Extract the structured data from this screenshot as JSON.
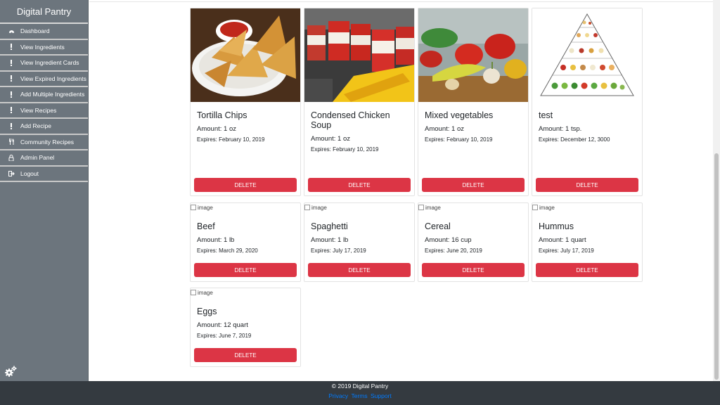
{
  "sidebar": {
    "brand": "Digital Pantry",
    "items": [
      {
        "label": "Dashboard",
        "icon": "dashboard-icon"
      },
      {
        "label": "View Ingredients",
        "icon": "exclamation-icon"
      },
      {
        "label": "View Ingredient Cards",
        "icon": "exclamation-icon"
      },
      {
        "label": "View Expired Ingredients",
        "icon": "exclamation-icon"
      },
      {
        "label": "Add Multiple Ingredients",
        "icon": "exclamation-icon"
      },
      {
        "label": "View Recipes",
        "icon": "exclamation-icon"
      },
      {
        "label": "Add Recipe",
        "icon": "exclamation-icon"
      },
      {
        "label": "Community Recipes",
        "icon": "utensils-icon"
      },
      {
        "label": "Admin Panel",
        "icon": "lock-icon"
      },
      {
        "label": "Logout",
        "icon": "logout-icon"
      }
    ]
  },
  "cards": [
    {
      "title": "Tortilla Chips",
      "amount": "Amount: 1 oz",
      "expires": "Expires: February 10, 2019",
      "delete_label": "DELETE",
      "image": "tortilla-chips"
    },
    {
      "title": "Condensed Chicken Soup",
      "amount": "Amount: 1 oz",
      "expires": "Expires: February 10, 2019",
      "delete_label": "DELETE",
      "image": "chicken-soup-cans"
    },
    {
      "title": "Mixed vegetables",
      "amount": "Amount: 1 oz",
      "expires": "Expires: February 10, 2019",
      "delete_label": "DELETE",
      "image": "mixed-vegetables"
    },
    {
      "title": "test",
      "amount": "Amount: 1 tsp.",
      "expires": "Expires: December 12, 3000",
      "delete_label": "DELETE",
      "image": "food-pyramid"
    },
    {
      "title": "Beef",
      "amount": "Amount: 1 lb",
      "expires": "Expires: March 29, 2020",
      "delete_label": "DELETE",
      "alt": "image"
    },
    {
      "title": "Spaghetti",
      "amount": "Amount: 1 lb",
      "expires": "Expires: July 17, 2019",
      "delete_label": "DELETE",
      "alt": "image"
    },
    {
      "title": "Cereal",
      "amount": "Amount: 16 cup",
      "expires": "Expires: June 20, 2019",
      "delete_label": "DELETE",
      "alt": "image"
    },
    {
      "title": "Hummus",
      "amount": "Amount: 1 quart",
      "expires": "Expires: July 17, 2019",
      "delete_label": "DELETE",
      "alt": "image"
    },
    {
      "title": "Eggs",
      "amount": "Amount: 12 quart",
      "expires": "Expires: June 7, 2019",
      "delete_label": "DELETE",
      "alt": "image"
    }
  ],
  "footer": {
    "copyright": "© 2019 Digital Pantry",
    "links": [
      "Privacy",
      "Terms",
      "Support"
    ]
  },
  "colors": {
    "sidebar": "#6c757d",
    "danger": "#dc3545",
    "footer": "#343a40",
    "link": "#007bff"
  }
}
